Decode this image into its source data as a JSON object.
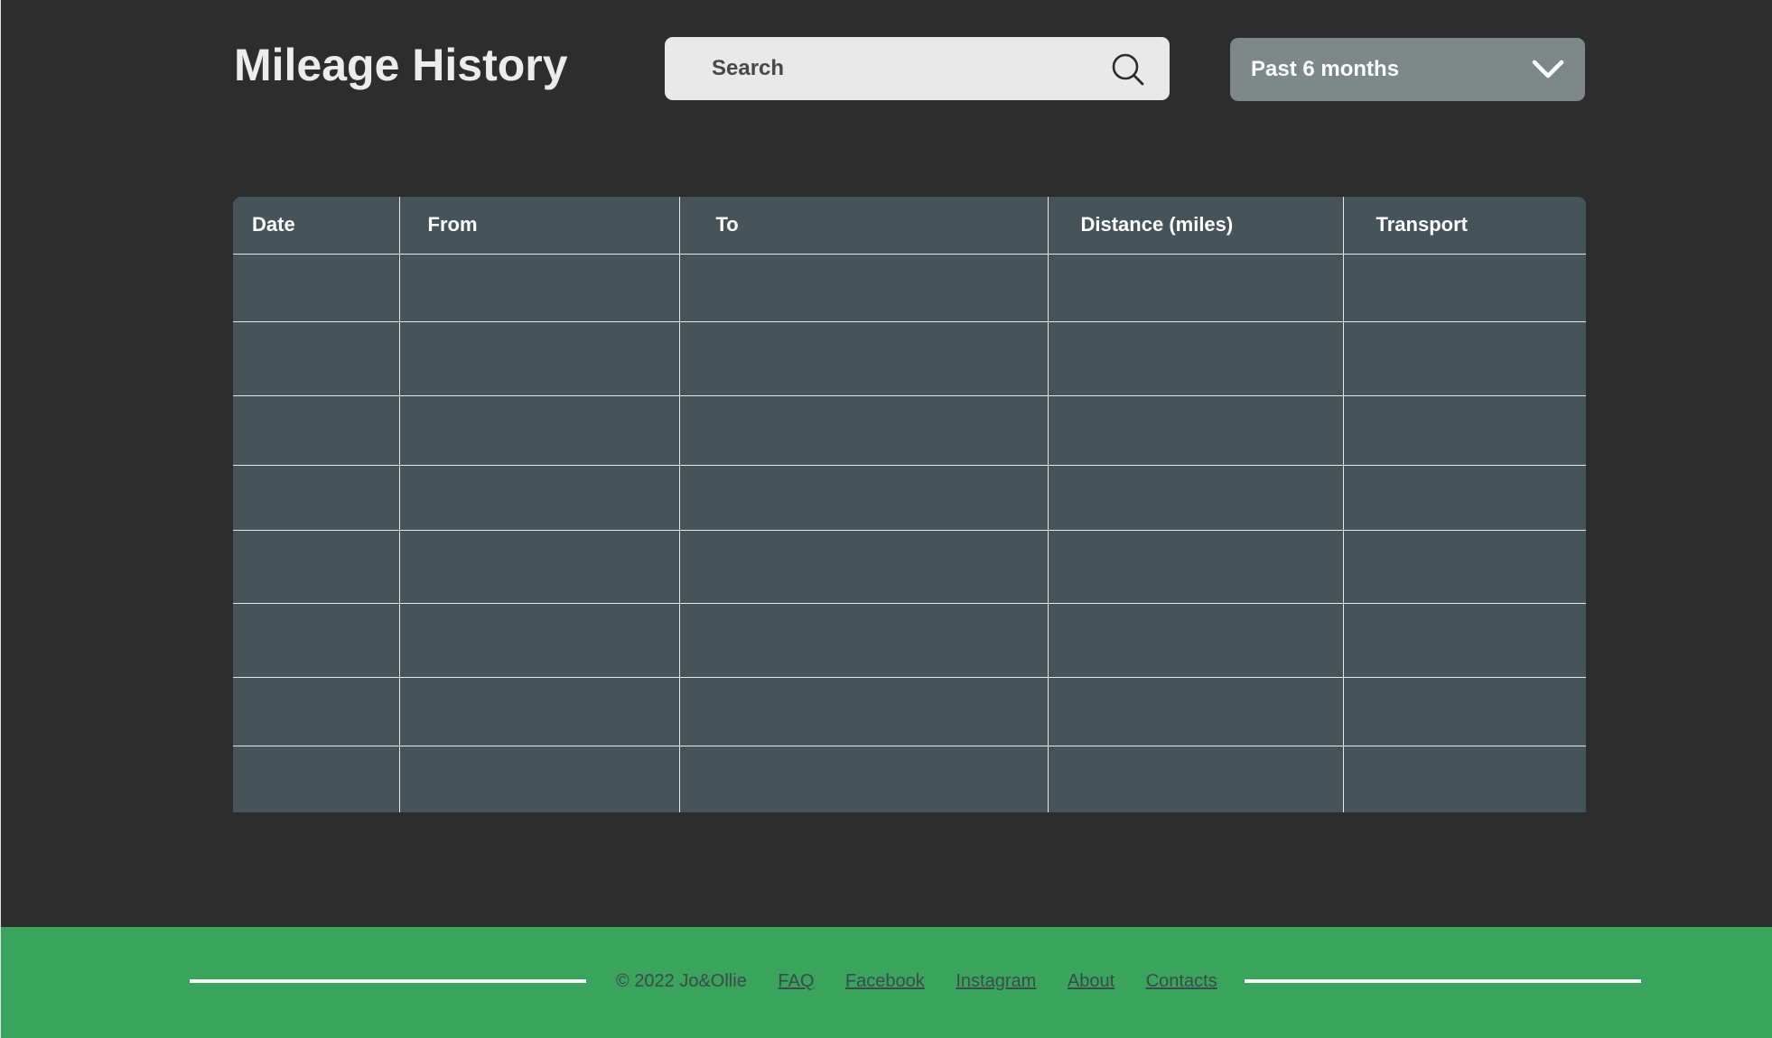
{
  "header": {
    "title": "Mileage History"
  },
  "search": {
    "placeholder": "Search",
    "value": ""
  },
  "filter": {
    "selected": "Past 6 months"
  },
  "table": {
    "columns": [
      "Date",
      "From",
      "To",
      "Distance (miles)",
      "Transport"
    ],
    "rows": [
      [
        "",
        "",
        "",
        "",
        ""
      ],
      [
        "",
        "",
        "",
        "",
        ""
      ],
      [
        "",
        "",
        "",
        "",
        ""
      ],
      [
        "",
        "",
        "",
        "",
        ""
      ],
      [
        "",
        "",
        "",
        "",
        ""
      ],
      [
        "",
        "",
        "",
        "",
        ""
      ],
      [
        "",
        "",
        "",
        "",
        ""
      ],
      [
        "",
        "",
        "",
        "",
        ""
      ]
    ]
  },
  "footer": {
    "copyright": "© 2022 Jo&Ollie",
    "links": [
      "FAQ",
      "Facebook",
      "Instagram",
      "About",
      "Contacts"
    ]
  },
  "colors": {
    "background": "#2d2d2d",
    "table_fill": "#465459",
    "footer_green": "#3aa45d",
    "select_fill": "#7f8889",
    "search_fill": "#e9e9e9"
  },
  "icons": {
    "search": "search-icon",
    "dropdown": "chevron-down-icon"
  }
}
